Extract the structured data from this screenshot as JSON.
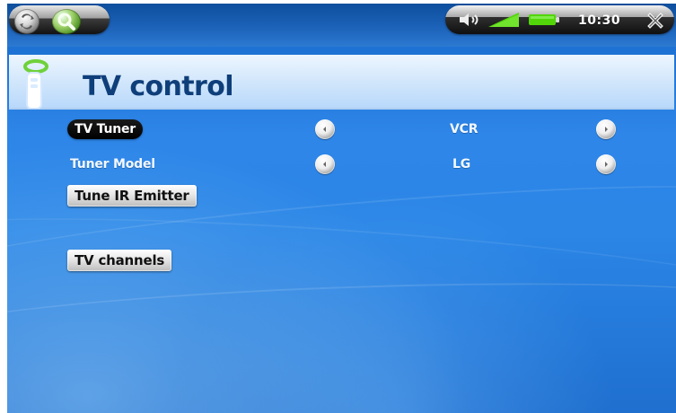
{
  "status_bar": {
    "time": "10:30",
    "icons": [
      "back-icon",
      "search-icon",
      "volume-icon",
      "signal-icon",
      "battery-icon",
      "close-icon"
    ]
  },
  "page": {
    "title": "TV control",
    "title_icon": "remote-control-icon"
  },
  "settings": [
    {
      "label": "TV Tuner",
      "value": "VCR"
    },
    {
      "label": "Tuner Model",
      "value": "LG"
    }
  ],
  "buttons": {
    "tune_ir_emitter": "Tune IR Emitter",
    "tv_channels": "TV channels"
  },
  "colors": {
    "background_top": "#1567c8",
    "background_mid": "#2e86e8",
    "title_text": "#0f3f7a",
    "status_green": "#52d60a"
  }
}
